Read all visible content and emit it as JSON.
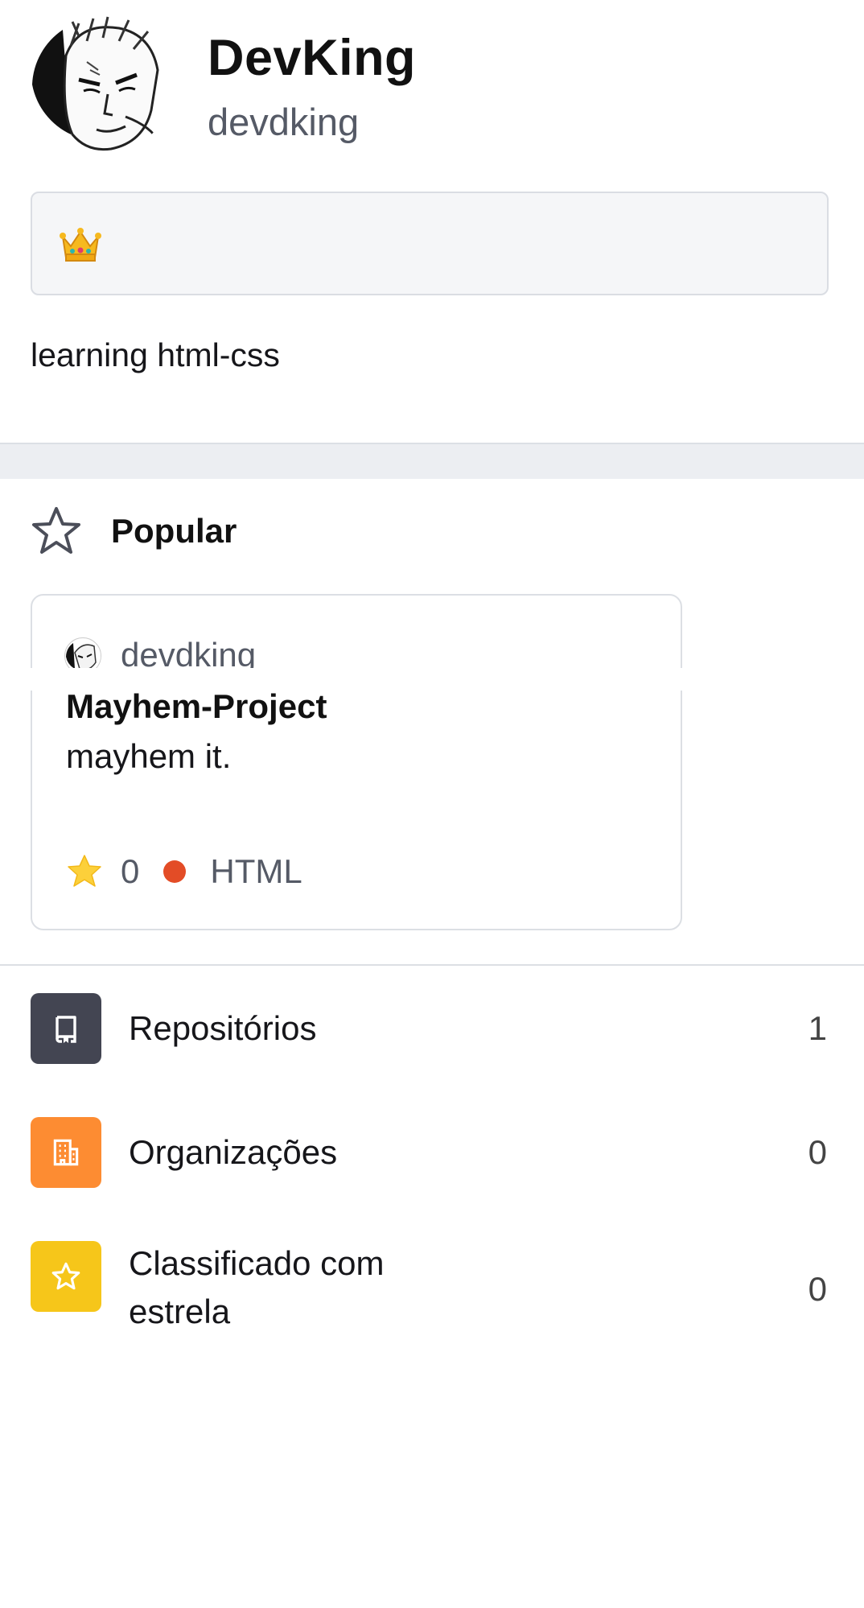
{
  "profile": {
    "name": "DevKing",
    "login": "devdking",
    "status_emoji": "crown-icon",
    "bio": "learning html-css"
  },
  "popular": {
    "title": "Popular",
    "repo": {
      "owner": "devdking",
      "name": "Mayhem-Project",
      "description": "mayhem it.",
      "stars": "0",
      "language": "HTML",
      "language_color": "#e34c26"
    }
  },
  "menu": [
    {
      "label": "Repositórios",
      "count": "1",
      "icon": "repo-icon",
      "color": "#434552"
    },
    {
      "label": "Organizações",
      "count": "0",
      "icon": "organization-icon",
      "color": "#fd8c32"
    },
    {
      "label": "Classificado com estrela",
      "count": "0",
      "icon": "star-icon",
      "color": "#f6c61a"
    }
  ]
}
